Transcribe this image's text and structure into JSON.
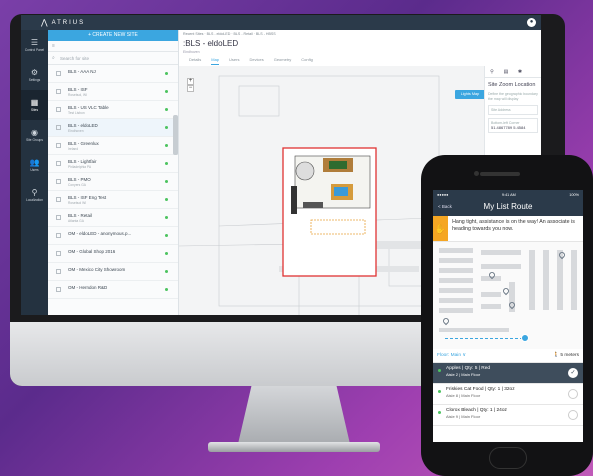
{
  "desktop": {
    "brand": "ATRIUS",
    "rail": [
      {
        "icon": "☰",
        "label": "Control Panel"
      },
      {
        "icon": "⚙",
        "label": "Settings"
      },
      {
        "icon": "▦",
        "label": "Sites"
      },
      {
        "icon": "◉",
        "label": "Site Groups"
      },
      {
        "icon": "👥",
        "label": "Users"
      },
      {
        "icon": "⚲",
        "label": "Localization"
      }
    ],
    "create_button": "+ CREATE NEW SITE",
    "search_placeholder": "Search for site",
    "sites": [
      {
        "name": "BLS - AAA NJ",
        "sub": ""
      },
      {
        "name": "BLS - ISF",
        "sub": "Rosebud, WI"
      },
      {
        "name": "BLS - US VLC Table",
        "sub": "Test Lisbon"
      },
      {
        "name": "BLS - eldoLED",
        "sub": "Eindhoven"
      },
      {
        "name": "BLS - Greenlux",
        "sub": "Ireland"
      },
      {
        "name": "BLS - Lightfair",
        "sub": "Philadelphia PA"
      },
      {
        "name": "BLS - PMO",
        "sub": "Conyers GA"
      },
      {
        "name": "BLS - ISF Eng Test",
        "sub": "Rosebud WI"
      },
      {
        "name": "BLS - Retail",
        "sub": "Atlanta GA"
      },
      {
        "name": "OM - eldoLED - anonymous.p...",
        "sub": ""
      },
      {
        "name": "OM - Global Shop 2016",
        "sub": ""
      },
      {
        "name": "OM - Mexico City Showroom",
        "sub": ""
      },
      {
        "name": "OM - Herndon R&D",
        "sub": ""
      }
    ],
    "breadcrumb": "Recent Sites · BLS - eldoLED · BLS - Retail · BLS - HBSS",
    "site_title": ":BLS - eldoLED",
    "site_sub": "Eindhoven",
    "tabs": [
      "Details",
      "Map",
      "Users",
      "Devices",
      "Geometry",
      "Config"
    ],
    "lights_button": "Lights Map",
    "side_panel": {
      "title": "Site Zoom Location",
      "desc": "Define the geographic boundary the map will display",
      "field1_label": "Site Address",
      "field1_value": "",
      "field2_label": "Bottom-left Corner",
      "field2_value": "51.4867789 5.4584"
    }
  },
  "phone": {
    "status_left": "●●●●● ",
    "status_time": "9:41 AM",
    "status_right": "100%",
    "back": "< Back",
    "title": "My List Route",
    "alert": "Hang tight, assistance is on the way! An associate is heading towards you now.",
    "floor": "Floor: Main ∨",
    "distance": "🚶 5 meters",
    "items": [
      {
        "title": "Apples | Qty: 5 | Red",
        "sub": "Aisle 2 | Main Floor",
        "done": true
      },
      {
        "title": "Friskies Cat Food | Qty: 1 | 32oz",
        "sub": "Aisle 8 | Main Floor",
        "done": false
      },
      {
        "title": "Clorox Bleach | Qty: 1 | 24oz",
        "sub": "Aisle 9 | Main Floor",
        "done": false
      }
    ]
  }
}
